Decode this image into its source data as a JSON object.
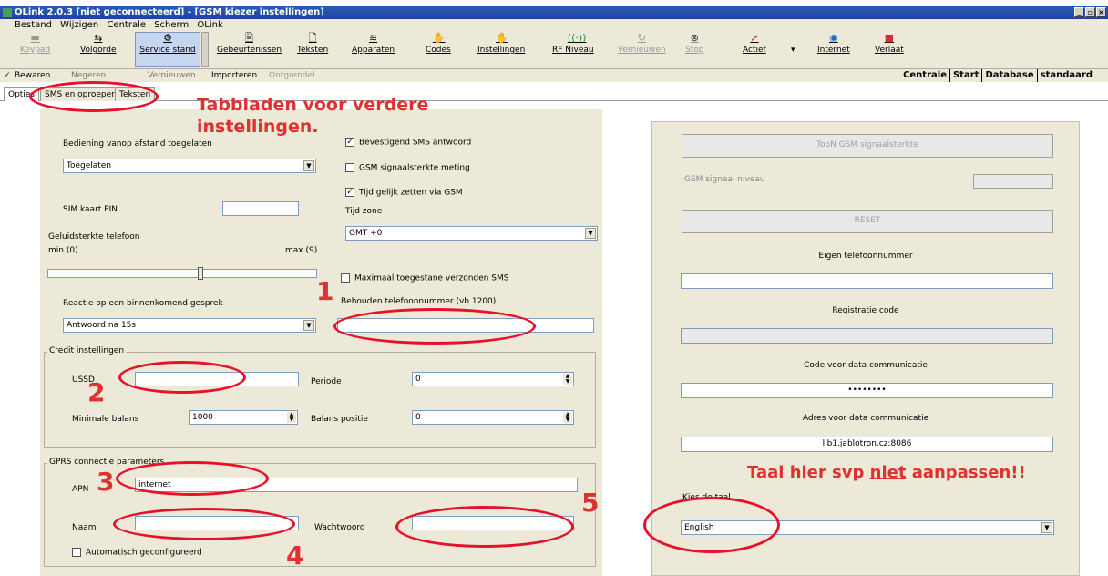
{
  "window": {
    "title": "OLink 2.0.3 [niet geconnecteerd] - [GSM kiezer instellingen]"
  },
  "menu": [
    "Bestand",
    "Wijzigen",
    "Centrale",
    "Scherm",
    "OLink"
  ],
  "toolbar": {
    "keypad": "Keypad",
    "volgorde": "Volgorde",
    "service": "Service stand",
    "gebeurtenissen": "Gebeurtenissen",
    "teksten": "Teksten",
    "apparaten": "Apparaten",
    "codes": "Codes",
    "instellingen": "Instellingen",
    "rf": "RF Niveau",
    "vernieuwen": "Vernieuwen",
    "stop": "Stop",
    "actief": "Actief",
    "internet": "Internet",
    "verlaat": "Verlaat"
  },
  "subbar": {
    "bewaren": "Bewaren",
    "annuleren": "Negeren",
    "vernieuwen": "Vernieuwen",
    "importeren": "Importeren",
    "ontgrendel": "Ontgrendel"
  },
  "right_tabs": [
    "Centrale",
    "Start",
    "Database",
    "standaard"
  ],
  "tabs": {
    "opties": "Opties",
    "sms": "SMS en oproepen",
    "teksten": "Teksten"
  },
  "left": {
    "bediening_label": "Bediening vanop afstand toegelaten",
    "bediening_value": "Toegelaten",
    "sim_label": "SIM kaart PIN",
    "geluid_label": "Geluidsterkte telefoon",
    "min_label": "min.(0)",
    "max_label": "max.(9)",
    "reactie_label": "Reactie op een binnenkomend gesprek",
    "reactie_value": "Antwoord na 15s",
    "bevestigend": "Bevestigend SMS antwoord",
    "signaal_meting": "GSM signaalsterkte meting",
    "tijd_gsm": "Tijd gelijk zetten via GSM",
    "tijdzone_label": "Tijd zone",
    "tijdzone_value": "GMT +0",
    "max_sms": "Maximaal toegestane verzonden SMS",
    "behouden_label": "Behouden telefoonnummer (vb 1200)",
    "credit_title": "Credit instellingen",
    "ussd": "USSD",
    "periode": "Periode",
    "periode_value": "0",
    "minimale": "Minimale balans",
    "minimale_value": "1000",
    "balans_positie": "Balans positie",
    "balans_value": "0",
    "gprs_title": "GPRS connectie parameters",
    "apn": "APN",
    "apn_value": "internet",
    "naam": "Naam",
    "wachtwoord": "Wachtwoord",
    "auto": "Automatisch geconfigureerd"
  },
  "right": {
    "toon_btn": "TooN GSM signaalsterkte",
    "signaal_niveau": "GSM signaal niveau",
    "reset_btn": "RESET",
    "eigen_tel": "Eigen telefoonnummer",
    "registratie": "Registratie code",
    "code_data": "Code voor data communicatie",
    "code_value": "••••••••",
    "adres_data": "Adres voor data communicatie",
    "adres_value": "lib1.jablotron.cz:8086",
    "kies_taal": "Kies de taal",
    "taal_value": "English"
  },
  "annotations": {
    "tabbladen": "Tabbladen voor verdere instellingen.",
    "taal_warning_1": "Taal hier svp ",
    "taal_warning_niet": "niet",
    "taal_warning_2": " aanpassen!!",
    "n1": "1",
    "n2": "2",
    "n3": "3",
    "n4": "4",
    "n5": "5"
  },
  "colors": {
    "annotation": "#e03030",
    "titlebar": "#2c5bb8",
    "panel": "#ece9d8"
  }
}
